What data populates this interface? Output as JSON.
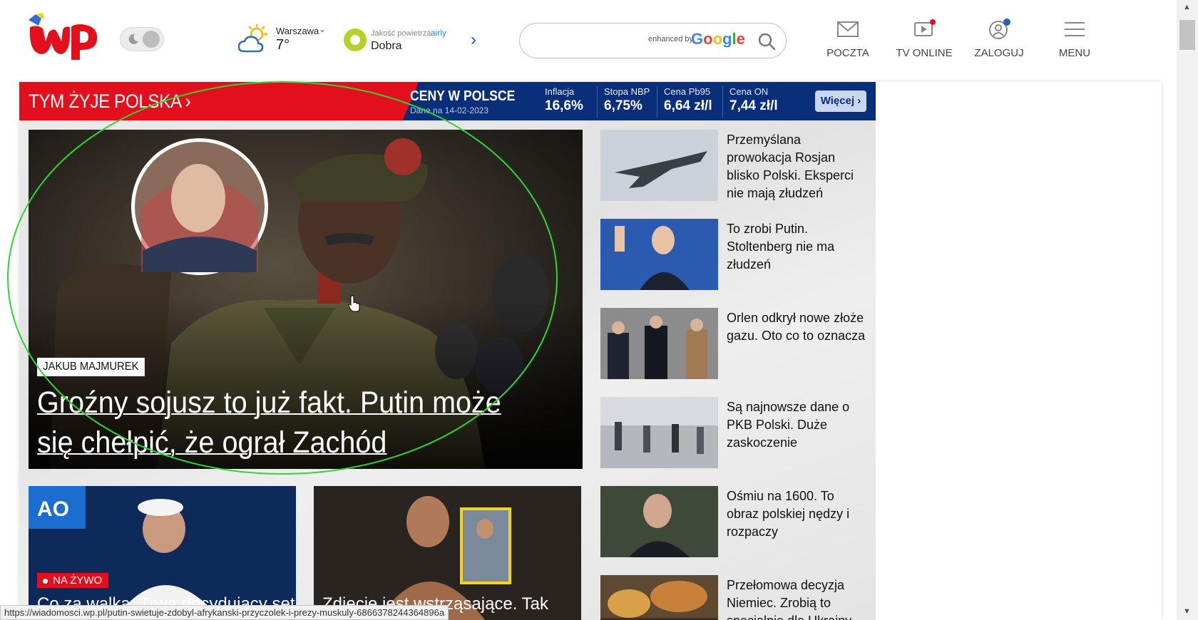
{
  "header": {
    "theme_toggle_state": "light",
    "weather": {
      "city": "Warszawa",
      "temperature": "7°"
    },
    "air_quality": {
      "label": "Jakość powietrza:",
      "provider": "airly",
      "value": "Dobra"
    },
    "search": {
      "placeholder": "",
      "enhanced_by": "enhanced by",
      "google": "Google"
    },
    "nav": [
      {
        "label": "POCZTA",
        "icon": "mail-icon"
      },
      {
        "label": "TV ONLINE",
        "icon": "tv-play-icon"
      },
      {
        "label": "ZALOGUJ",
        "icon": "user-icon"
      },
      {
        "label": "MENU",
        "icon": "hamburger-icon"
      }
    ]
  },
  "banner": {
    "slogan": "TYM ŻYJE POLSKA",
    "prices_title": "CENY W POLSCE",
    "prices_date": "Dane na 14-02-2023",
    "stats": [
      {
        "label": "Inflacja",
        "value": "16,6%"
      },
      {
        "label": "Stopa NBP",
        "value": "6,75%"
      },
      {
        "label": "Cena Pb95",
        "value": "6,64 zł/l"
      },
      {
        "label": "Cena ON",
        "value": "7,44 zł/l"
      }
    ],
    "more_label": "Więcej"
  },
  "hero": {
    "author": "JAKUB MAJMUREK",
    "headline": "Groźny sojusz to już fakt. Putin może się chełpić, że ograł Zachód"
  },
  "side_articles": [
    {
      "title": "Przemyślana prowokacja Rosjan blisko Polski. Eksperci nie mają złudzeń"
    },
    {
      "title": "To zrobi Putin. Stoltenberg nie ma złudzeń"
    },
    {
      "title": "Orlen odkrył nowe złoże gazu. Oto co to oznacza"
    },
    {
      "title": "Są najnowsze dane o PKB Polski. Duże zaskoczenie"
    },
    {
      "title": "Ośmiu na 1600. To obraz polskiej nędzy i rozpaczy"
    },
    {
      "title": "Przełomowa decyzja Niemiec. Zrobią to specjalnie dla Ukrainy"
    }
  ],
  "cards": [
    {
      "badge": "NA ŻYWO",
      "title": "Co za walka. Trwa decydujący set"
    },
    {
      "badge": "",
      "title": "Zdjęcie jest wstrząsające. Tak"
    }
  ],
  "status_url": "https://wiadomosci.wp.pl/putin-swietuje-zdobyl-afrykanski-przyczolek-i-prezy-muskuly-6866378244364896a",
  "colors": {
    "brand_red": "#e30f1c",
    "banner_blue": "#0a2f7a",
    "annotation_green": "#2fd62f"
  }
}
